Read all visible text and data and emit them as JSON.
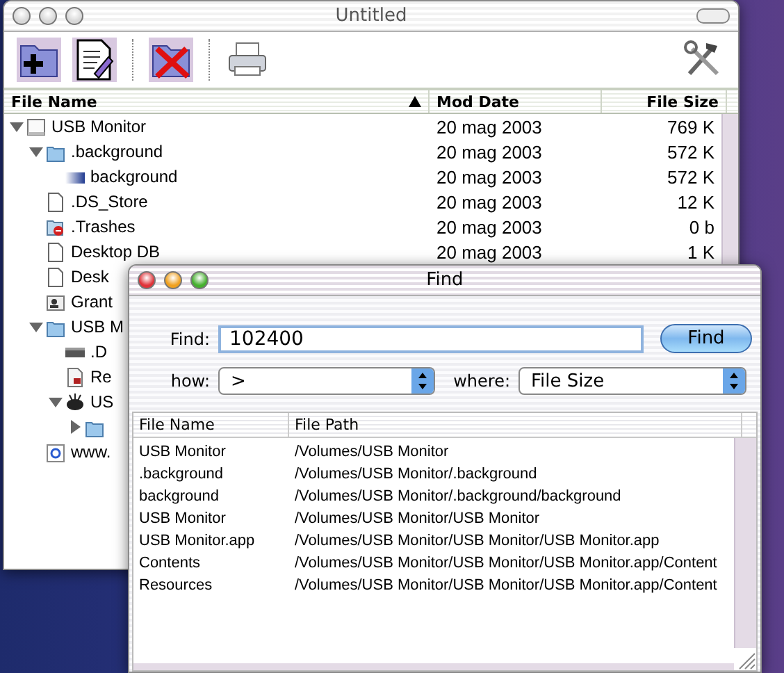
{
  "browser_window": {
    "title": "Untitled",
    "active": false,
    "columns": [
      {
        "label": "File Name",
        "sorted": true
      },
      {
        "label": "Mod Date",
        "sorted": false
      },
      {
        "label": "File Size",
        "sorted": false
      }
    ],
    "tree": [
      {
        "name": "USB Monitor",
        "kind": "drive",
        "date": "20 mag 2003",
        "size": "769 K",
        "expanded": true,
        "children": [
          {
            "name": ".background",
            "kind": "folder",
            "date": "20 mag 2003",
            "size": "572 K",
            "expanded": true,
            "children": [
              {
                "name": "background",
                "kind": "image",
                "date": "20 mag 2003",
                "size": "572 K"
              }
            ]
          },
          {
            "name": ".DS_Store",
            "kind": "document",
            "date": "20 mag 2003",
            "size": "12 K"
          },
          {
            "name": ".Trashes",
            "kind": "trash",
            "date": "20 mag 2003",
            "size": "0 b"
          },
          {
            "name": "Desktop DB",
            "kind": "document",
            "date": "20 mag 2003",
            "size": "1 K"
          },
          {
            "name": "Desk",
            "kind": "document"
          },
          {
            "name": "Grant",
            "kind": "contact"
          },
          {
            "name": "USB M",
            "kind": "folder",
            "expanded": true,
            "children": [
              {
                "name": ".D",
                "kind": "bundle"
              },
              {
                "name": "Re",
                "kind": "resource"
              },
              {
                "name": "US",
                "kind": "app",
                "expanded": true,
                "children": [
                  {
                    "kind": "folder",
                    "expanded": false
                  }
                ]
              }
            ]
          },
          {
            "name": "www.",
            "kind": "link"
          }
        ]
      }
    ]
  },
  "find_window": {
    "title": "Find",
    "active": true,
    "find_label": "Find:",
    "find_value": "102400",
    "find_button": "Find",
    "how_label": "how:",
    "how_value": ">",
    "where_label": "where:",
    "where_value": "File Size",
    "columns": [
      "File Name",
      "File Path"
    ],
    "results": [
      {
        "name": "USB Monitor",
        "path": "/Volumes/USB Monitor"
      },
      {
        "name": ".background",
        "path": "/Volumes/USB Monitor/.background"
      },
      {
        "name": "background",
        "path": "/Volumes/USB Monitor/.background/background"
      },
      {
        "name": "USB Monitor",
        "path": "/Volumes/USB Monitor/USB Monitor"
      },
      {
        "name": "USB Monitor.app",
        "path": "/Volumes/USB Monitor/USB Monitor/USB Monitor.app"
      },
      {
        "name": "Contents",
        "path": "/Volumes/USB Monitor/USB Monitor/USB Monitor.app/Content"
      },
      {
        "name": "Resources",
        "path": "/Volumes/USB Monitor/USB Monitor/USB Monitor.app/Content"
      }
    ]
  }
}
